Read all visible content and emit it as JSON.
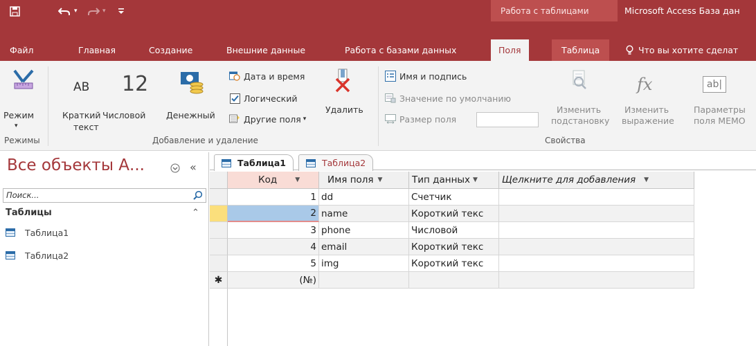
{
  "titlebar": {
    "context_label": "Работа с таблицами",
    "app_title": "Microsoft Access База дан"
  },
  "menu": {
    "tabs": [
      "Файл",
      "Главная",
      "Создание",
      "Внешние данные",
      "Работа с базами данных",
      "Поля",
      "Таблица"
    ],
    "tell_me": "Что вы хотите сделат"
  },
  "ribbon": {
    "mode_label": "Режим",
    "short_text_label_1": "Краткий",
    "short_text_label_2": "текст",
    "number_label": "Числовой",
    "number_icon_text": "12",
    "currency_label": "Денежный",
    "datetime_label": "Дата и время",
    "logical_label": "Логический",
    "other_fields_label": "Другие поля",
    "delete_label": "Удалить",
    "name_caption_label": "Имя и подпись",
    "default_value_label": "Значение по умолчанию",
    "field_size_label": "Размер поля",
    "change_lookup_1": "Изменить",
    "change_lookup_2": "подстановку",
    "change_expr_1": "Изменить",
    "change_expr_2": "выражение",
    "memo_params_1": "Параметры",
    "memo_params_2": "поля МЕМО",
    "ab_icon_text": "AB",
    "groups": {
      "modes": "Режимы",
      "add_delete": "Добавление и удаление",
      "properties": "Свойства"
    }
  },
  "nav": {
    "title": "Все объекты А...",
    "search_placeholder": "Поиск...",
    "section": "Таблицы",
    "items": [
      "Таблица1",
      "Таблица2"
    ]
  },
  "doc": {
    "tabs": [
      "Таблица1",
      "Таблица2"
    ]
  },
  "table": {
    "columns": [
      "Код",
      "Имя поля",
      "Тип данных",
      "Щелкните для добавления"
    ],
    "rows": [
      {
        "id": "1",
        "name": "dd",
        "type": "Счетчик"
      },
      {
        "id": "2",
        "name": "name",
        "type": "Короткий текс"
      },
      {
        "id": "3",
        "name": "phone",
        "type": "Числовой"
      },
      {
        "id": "4",
        "name": "email",
        "type": "Короткий текс"
      },
      {
        "id": "5",
        "name": "img",
        "type": "Короткий текс"
      }
    ],
    "new_row_marker": "(№)",
    "new_row_selector": "✱"
  }
}
